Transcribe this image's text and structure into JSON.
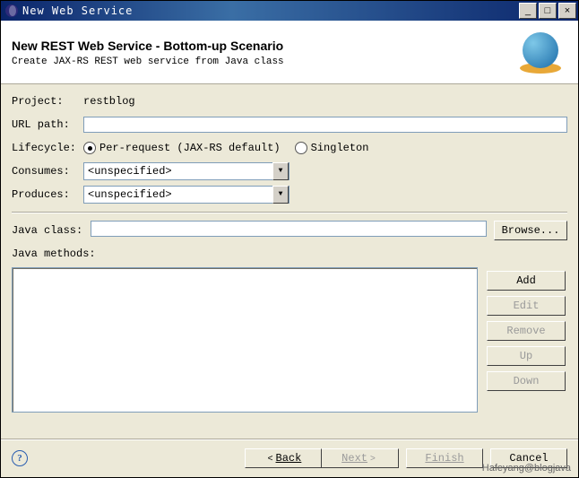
{
  "window": {
    "title": "New Web Service",
    "minimize": "_",
    "maximize": "□",
    "close": "×"
  },
  "header": {
    "title": "New REST Web Service - Bottom-up Scenario",
    "subtitle": "Create JAX-RS REST web service from Java class"
  },
  "form": {
    "project_label": "Project:",
    "project_value": "restblog",
    "url_label": "URL path:",
    "url_value": "",
    "lifecycle_label": "Lifecycle:",
    "lifecycle_opt1": "Per-request (JAX-RS default)",
    "lifecycle_opt2": "Singleton",
    "consumes_label": "Consumes:",
    "consumes_value": "<unspecified>",
    "produces_label": "Produces:",
    "produces_value": "<unspecified>",
    "javaclass_label": "Java class:",
    "javaclass_value": "",
    "browse_btn": "Browse...",
    "methods_label": "Java methods:"
  },
  "side": {
    "add": "Add",
    "edit": "Edit",
    "remove": "Remove",
    "up": "Up",
    "down": "Down"
  },
  "nav": {
    "back": "Back",
    "next": "Next",
    "finish": "Finish",
    "cancel": "Cancel",
    "help": "?"
  },
  "watermark": "Hafeyang@blogjava"
}
